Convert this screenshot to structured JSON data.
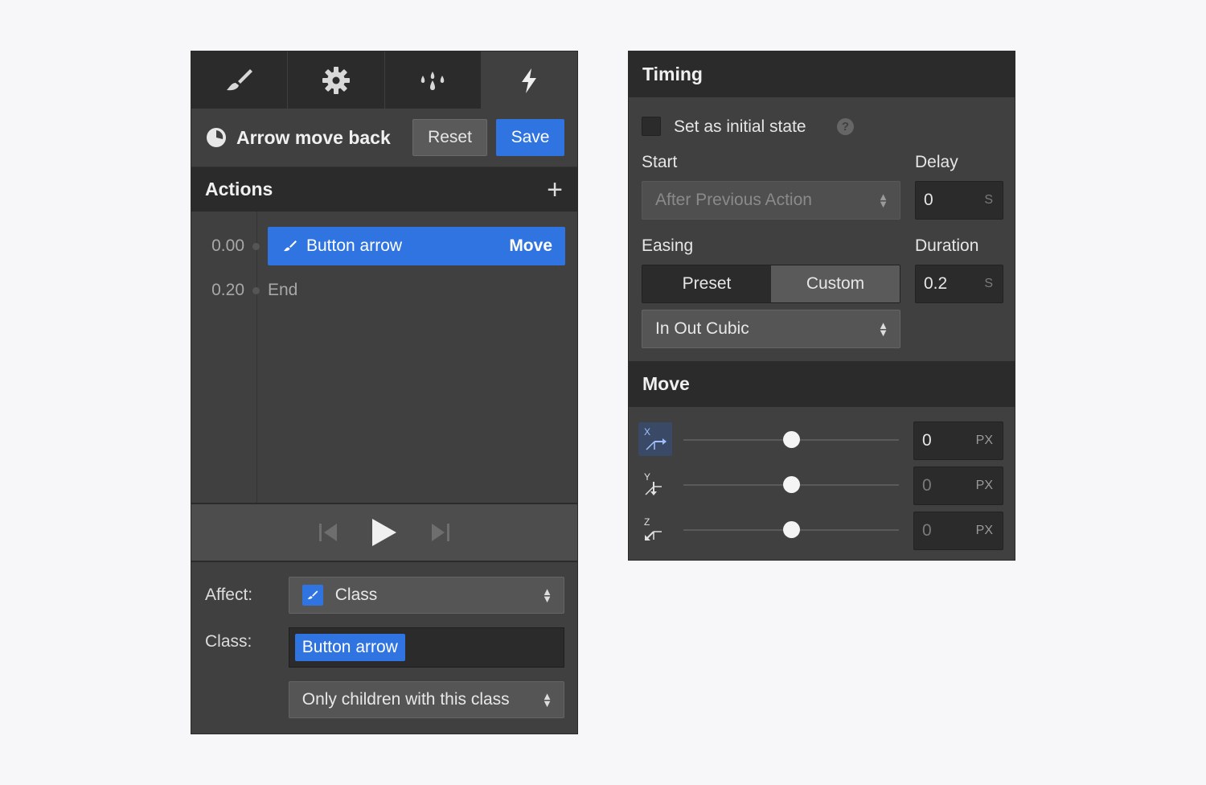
{
  "left": {
    "tabs": [
      {
        "icon": "paintbrush-icon"
      },
      {
        "icon": "gear-icon"
      },
      {
        "icon": "drops-icon"
      },
      {
        "icon": "lightning-icon",
        "active": true
      }
    ],
    "interaction": {
      "title": "Arrow move back",
      "reset_label": "Reset",
      "save_label": "Save"
    },
    "actions": {
      "heading": "Actions",
      "rows": [
        {
          "time": "0.00",
          "target": "Button arrow",
          "type": "Move"
        },
        {
          "time": "0.20",
          "end_label": "End"
        }
      ]
    },
    "affect": {
      "affect_label": "Affect:",
      "affect_value": "Class",
      "class_label": "Class:",
      "class_tag": "Button arrow",
      "scope_value": "Only children with this class"
    }
  },
  "right": {
    "timing": {
      "heading": "Timing",
      "initial_state_label": "Set as initial state",
      "help_glyph": "?",
      "start_label": "Start",
      "start_value": "After Previous Action",
      "delay_label": "Delay",
      "delay_value": "0",
      "delay_unit": "S",
      "easing_label": "Easing",
      "preset_label": "Preset",
      "custom_label": "Custom",
      "duration_label": "Duration",
      "duration_value": "0.2",
      "duration_unit": "S",
      "easing_value": "In Out Cubic"
    },
    "move": {
      "heading": "Move",
      "axes": [
        {
          "axis": "X",
          "value": "0",
          "unit": "PX",
          "slider_fraction": 0.5
        },
        {
          "axis": "Y",
          "value": "0",
          "unit": "PX",
          "slider_fraction": 0.5
        },
        {
          "axis": "Z",
          "value": "0",
          "unit": "PX",
          "slider_fraction": 0.5
        }
      ]
    }
  },
  "colors": {
    "accent": "#2f74e0",
    "panel": "#404040",
    "panel_dark": "#2b2b2b"
  }
}
